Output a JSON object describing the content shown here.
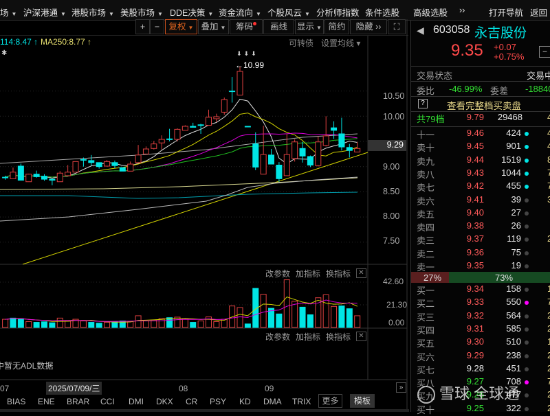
{
  "menu": [
    {
      "label": "场",
      "dd": true
    },
    {
      "label": "沪深港通",
      "dd": true
    },
    {
      "label": "港股市场",
      "dd": true
    },
    {
      "label": "美股市场",
      "dd": true
    },
    {
      "label": "DDE决策",
      "dd": true
    },
    {
      "label": "资金流向",
      "dd": true
    },
    {
      "label": "个股风云",
      "dd": true
    },
    {
      "label": "分析师指数",
      "dd": false
    },
    {
      "label": "条件选股",
      "dd": false
    },
    {
      "label": "高级选股",
      "dd": false
    },
    {
      "label": "››",
      "dd": false
    },
    {
      "label": "打开导航",
      "dd": false
    },
    {
      "label": "返回",
      "dd": false
    }
  ],
  "toolbar": {
    "plus": "+",
    "minus": "−",
    "fuquan": "复权",
    "diejia": "叠加",
    "chouma": "筹码",
    "huaxian": "画线",
    "xianshi": "显示",
    "jianyue": "简约",
    "yincang": "隐藏 ››",
    "fullscreen": "⛶"
  },
  "legend": {
    "ma114": "114:8.47 ↑",
    "ma250": "MA250:8.77 ↑",
    "kezhuanzhai": "可转债",
    "shezhi": "设置均线 ▾",
    "star": "✱"
  },
  "price_axis": [
    "10.50",
    "10.00",
    "9.00",
    "8.50",
    "8.00",
    "7.50"
  ],
  "current_price_tag": "9.29",
  "high_marker": "←10.99",
  "volume_panel": {
    "btn_param": "改参数",
    "btn_add": "加指标",
    "btn_switch": "换指标",
    "axis": [
      "42.60",
      "21.30",
      "0.00"
    ]
  },
  "adl_panel": {
    "btn_param": "改参数",
    "btn_add": "加指标",
    "btn_switch": "换指标",
    "message": "中暂无ADL数据"
  },
  "date_axis": {
    "m07": "07",
    "cursor": "2025/07/09/三",
    "m08": "08",
    "m09": "09"
  },
  "indicator_tabs": [
    "BIAS",
    "ENE",
    "BRAR",
    "CCI",
    "DMI",
    "DKX",
    "CR",
    "PSY",
    "KD",
    "DMA",
    "TRIX"
  ],
  "more": "更多",
  "template": "模板",
  "stock": {
    "code": "603058",
    "name": "永吉股份",
    "price": "9.35",
    "change": "+0.07",
    "change_pct": "+0.75%"
  },
  "status": {
    "label": "交易状态",
    "value": "交易中"
  },
  "weibi": {
    "label": "委比",
    "value": "-46.99%",
    "wc_label": "委差",
    "wc_value": "-18840"
  },
  "full_book": "查看完整档买卖盘",
  "total": {
    "label": "共79档",
    "price": "9.79",
    "vol": "29468",
    "c4": "4"
  },
  "asks": [
    {
      "l": "十一",
      "p": "9.46",
      "v": "424",
      "d": "#00e5e5",
      "c4": "4."
    },
    {
      "l": "卖十",
      "p": "9.45",
      "v": "901",
      "d": "#00e5e5",
      "c4": "4"
    },
    {
      "l": "卖九",
      "p": "9.44",
      "v": "1519",
      "d": "#00e5e5",
      "c4": "8"
    },
    {
      "l": "卖八",
      "p": "9.43",
      "v": "1044",
      "d": "#00e5e5",
      "c4": "7"
    },
    {
      "l": "卖七",
      "p": "9.42",
      "v": "455",
      "d": "#00e5e5",
      "c4": "7"
    },
    {
      "l": "卖六",
      "p": "9.41",
      "v": "39",
      "d": "#444",
      "c4": "3"
    },
    {
      "l": "卖五",
      "p": "9.40",
      "v": "27",
      "d": "#444",
      "c4": ""
    },
    {
      "l": "卖四",
      "p": "9.38",
      "v": "26",
      "d": "#444",
      "c4": ""
    },
    {
      "l": "卖三",
      "p": "9.37",
      "v": "119",
      "d": "#444",
      "c4": "2"
    },
    {
      "l": "卖二",
      "p": "9.36",
      "v": "75",
      "d": "#444",
      "c4": ""
    },
    {
      "l": "卖一",
      "p": "9.35",
      "v": "19",
      "d": "#444",
      "c4": ""
    }
  ],
  "ratio": {
    "buy": "27%",
    "sell": "73%",
    "buy_frac": 0.27
  },
  "bids": [
    {
      "l": "买一",
      "p": "9.34",
      "v": "158",
      "d": "#444",
      "c4": "1",
      "col": "#ff5a5a"
    },
    {
      "l": "买二",
      "p": "9.33",
      "v": "550",
      "d": "#f0f",
      "c4": "7",
      "col": "#ff5a5a"
    },
    {
      "l": "买三",
      "p": "9.32",
      "v": "564",
      "d": "#444",
      "c4": "2",
      "col": "#ff5a5a"
    },
    {
      "l": "买四",
      "p": "9.31",
      "v": "585",
      "d": "#444",
      "c4": "2",
      "col": "#ff5a5a"
    },
    {
      "l": "买五",
      "p": "9.30",
      "v": "510",
      "d": "#444",
      "c4": "1",
      "col": "#ff5a5a"
    },
    {
      "l": "买六",
      "p": "9.29",
      "v": "238",
      "d": "#444",
      "c4": "2",
      "col": "#ff5a5a"
    },
    {
      "l": "买七",
      "p": "9.28",
      "v": "451",
      "d": "#444",
      "c4": "2",
      "col": "#e8e8e8"
    },
    {
      "l": "买八",
      "p": "9.27",
      "v": "708",
      "d": "#f0f",
      "c4": "7",
      "col": "#33e033"
    },
    {
      "l": "买九",
      "p": "9.26",
      "v": "477",
      "d": "#444",
      "c4": "2",
      "col": "#33e033"
    },
    {
      "l": "买十",
      "p": "9.25",
      "v": "322",
      "d": "#444",
      "c4": "2",
      "col": "#33e033"
    }
  ],
  "watermark": "雪球 全球通",
  "colors": {
    "up": "#e04040",
    "down": "#00e5e5",
    "accent": "#e0641e"
  },
  "chart_data": {
    "type": "candlestick",
    "candles": [
      [
        8.79,
        8.79,
        8.82,
        8.74
      ],
      [
        8.76,
        8.89,
        8.98,
        8.76
      ],
      [
        9.01,
        8.73,
        9.06,
        8.73
      ],
      [
        8.7,
        8.85,
        8.86,
        8.7
      ],
      [
        8.85,
        8.8,
        8.92,
        8.78
      ],
      [
        8.81,
        8.75,
        8.85,
        8.72
      ],
      [
        8.75,
        8.73,
        8.76,
        8.63
      ],
      [
        8.7,
        8.87,
        8.91,
        8.7
      ],
      [
        8.82,
        8.89,
        9.03,
        8.82
      ],
      [
        8.89,
        9.1,
        9.1,
        8.89
      ],
      [
        9.14,
        9.13,
        9.18,
        9.0
      ],
      [
        9.12,
        9.08,
        9.23,
        9.02
      ],
      [
        9.08,
        9.0,
        9.08,
        8.96
      ],
      [
        9.01,
        9.1,
        9.13,
        9.0
      ],
      [
        9.08,
        9.02,
        9.12,
        8.97
      ],
      [
        8.98,
        8.91,
        8.98,
        8.91
      ],
      [
        8.91,
        9.05,
        9.1,
        8.91
      ],
      [
        9.08,
        9.23,
        9.43,
        9.08
      ],
      [
        9.25,
        9.35,
        9.4,
        9.25
      ],
      [
        9.36,
        9.45,
        9.51,
        9.34
      ],
      [
        9.47,
        9.54,
        9.62,
        9.34
      ],
      [
        9.55,
        9.55,
        9.75,
        9.5
      ],
      [
        9.54,
        9.74,
        9.76,
        9.5
      ],
      [
        9.72,
        9.8,
        9.82,
        9.72
      ],
      [
        9.8,
        9.78,
        9.87,
        9.78
      ],
      [
        9.83,
        9.83,
        9.85,
        9.65
      ],
      [
        9.82,
        9.98,
        10.13,
        9.82
      ],
      [
        9.95,
        9.99,
        10.05,
        9.88
      ],
      [
        10.08,
        10.33,
        10.37,
        10.03
      ],
      [
        10.5,
        10.5,
        10.78,
        10.27
      ],
      [
        10.42,
        10.89,
        10.99,
        10.42
      ],
      [
        9.8,
        9.8,
        9.8,
        9.8
      ],
      [
        9.45,
        8.99,
        9.68,
        8.93
      ],
      [
        8.85,
        9.24,
        9.81,
        8.85
      ],
      [
        9.23,
        9.05,
        9.35,
        9.05
      ],
      [
        9.03,
        8.76,
        9.09,
        8.7
      ],
      [
        8.82,
        9.24,
        9.65,
        8.82
      ],
      [
        9.16,
        9.49,
        9.54,
        9.1
      ],
      [
        9.36,
        9.21,
        9.49,
        9.08
      ],
      [
        9.2,
        9.03,
        9.22,
        8.99
      ],
      [
        9.02,
        9.49,
        9.6,
        9.0
      ],
      [
        9.42,
        9.61,
        10.0,
        9.4
      ],
      [
        9.77,
        9.72,
        9.9,
        9.55
      ],
      [
        9.65,
        9.39,
        9.97,
        9.32
      ],
      [
        9.38,
        9.32,
        9.45,
        9.18
      ],
      [
        9.29,
        9.36,
        9.49,
        9.29
      ]
    ],
    "volumes": [
      7.7,
      8.8,
      8.3,
      5.5,
      4.8,
      5.3,
      4.4,
      8.8,
      5.9,
      7.7,
      6.1,
      4.8,
      4.0,
      4.8,
      5.5,
      6.1,
      5.5,
      11.0,
      6.1,
      7.0,
      8.3,
      9.2,
      9.7,
      8.3,
      4.8,
      6.1,
      9.9,
      5.5,
      7.7,
      20.2,
      18.7,
      3.3,
      36.7,
      31.2,
      18.0,
      12.7,
      44.8,
      24.6,
      19.1,
      11.9,
      27.9,
      30.7,
      19.8,
      20.2,
      17.6,
      11.0
    ],
    "volume_colors": "rccrcccrrrrccrccrrrrrcrrcrrrrrrccrccrrccrrrccr",
    "ylim": [
      7.3,
      11.1
    ],
    "vol_ylim": [
      0,
      42.6
    ]
  }
}
